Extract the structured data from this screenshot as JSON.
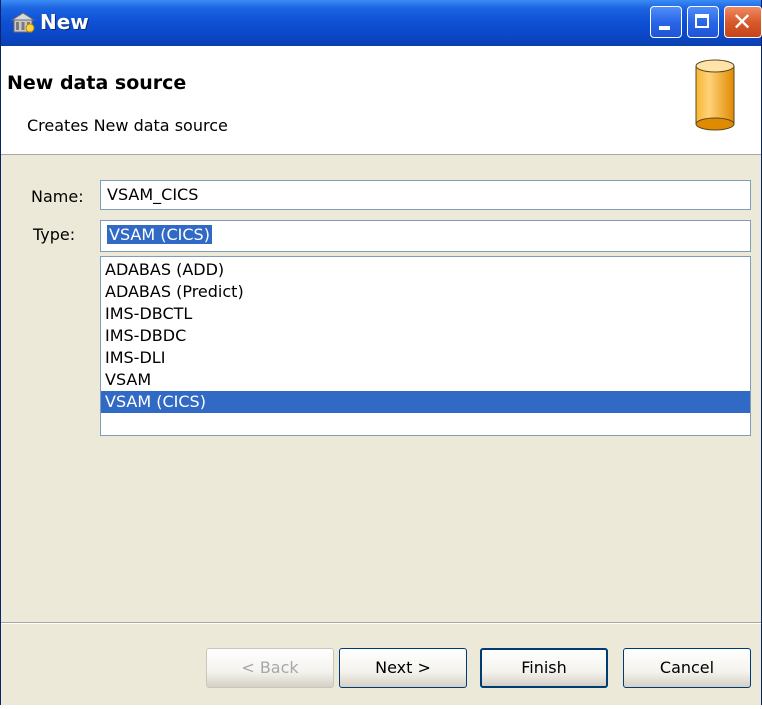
{
  "window": {
    "title": "New",
    "title_icon": "wizard-icon",
    "controls": [
      "minimize-icon",
      "maximize-icon",
      "close-icon"
    ]
  },
  "header": {
    "title": "New data source",
    "description": "Creates New data source",
    "icon": "database-cylinder-icon"
  },
  "form": {
    "name_label": "Name:",
    "name_value": "VSAM_CICS",
    "type_label": "Type:",
    "type_value": "VSAM (CICS)"
  },
  "type_list": {
    "items": [
      "ADABAS (ADD)",
      "ADABAS (Predict)",
      "IMS-DBCTL",
      "IMS-DBDC",
      "IMS-DLI",
      "VSAM",
      "VSAM (CICS)"
    ],
    "selected": "VSAM (CICS)"
  },
  "buttons": {
    "back": "< Back",
    "next": "Next >",
    "finish": "Finish",
    "cancel": "Cancel"
  },
  "colors": {
    "titlebar": "#0b48c8",
    "selection": "#316ac5",
    "dialog_bg": "#ece9d8",
    "db_icon": "#f5a623"
  }
}
